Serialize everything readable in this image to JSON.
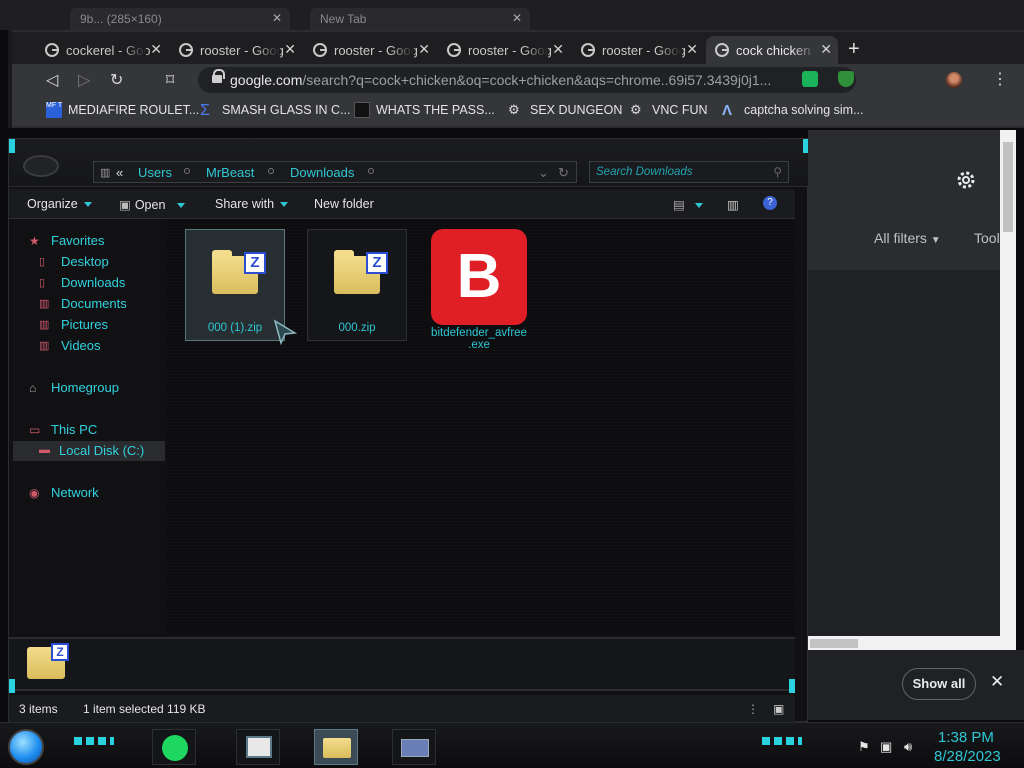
{
  "background_browser": {
    "tabs": [
      {
        "label": "9b... (285×160)"
      },
      {
        "label": "New Tab"
      }
    ]
  },
  "browser": {
    "tabs": [
      {
        "label": "cockerel - Goo"
      },
      {
        "label": "rooster - Goog"
      },
      {
        "label": "rooster - Goog"
      },
      {
        "label": "rooster - Goog"
      },
      {
        "label": "rooster - Goog"
      },
      {
        "label": "cock chicken"
      }
    ],
    "new_tab": "+",
    "url_host": "google.com",
    "url_rest": "/search?q=cock+chicken&oq=cock+chicken&aqs=chrome..69i57.3439j0j1...",
    "bookmarks": [
      {
        "label": "MEDIAFIRE ROULET..."
      },
      {
        "label": "SMASH GLASS IN C..."
      },
      {
        "label": "WHATS THE PASS..."
      },
      {
        "label": "SEX DUNGEON"
      },
      {
        "label": "VNC FUN"
      },
      {
        "label": "captcha solving sim..."
      }
    ],
    "menu_icon": "⋮"
  },
  "explorer": {
    "breadcrumb_prefix": "«",
    "breadcrumb": [
      "Users",
      "MrBeast",
      "Downloads"
    ],
    "search_placeholder": "Search Downloads",
    "commands": {
      "organize": "Organize",
      "open": "Open",
      "share_with": "Share with",
      "new_folder": "New folder"
    },
    "nav": {
      "favorites": "Favorites",
      "desktop": "Desktop",
      "downloads": "Downloads",
      "documents": "Documents",
      "pictures": "Pictures",
      "videos": "Videos",
      "homegroup": "Homegroup",
      "this_pc": "This PC",
      "local_disk": "Local Disk (C:)",
      "network": "Network"
    },
    "files": [
      {
        "name": "000 (1).zip",
        "selected": true
      },
      {
        "name": "000.zip",
        "selected": false
      },
      {
        "name": "bitdefender_avfree.exe",
        "name_line1": "bitdefender_avfree",
        "name_line2": ".exe",
        "selected": false
      }
    ],
    "status": {
      "count": "3 items",
      "selection": "1 item selected  119 KB"
    }
  },
  "google_panel": {
    "all_filters": "All filters",
    "tools": "Tools",
    "show_all": "Show all"
  },
  "taskbar": {
    "time": "1:38 PM",
    "date": "8/28/2023"
  },
  "colors": {
    "accent_cyan": "#2ec8d4",
    "bitdefender_red": "#e01e26"
  }
}
